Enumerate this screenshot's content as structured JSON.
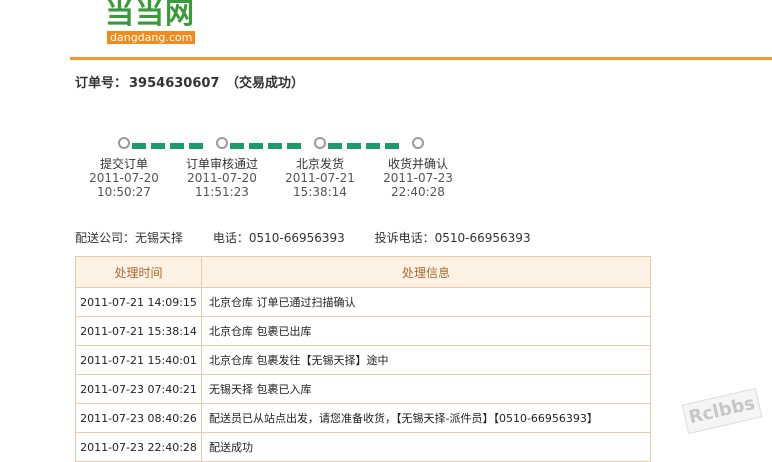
{
  "logo": {
    "cn": "当当网",
    "en": "dangdang.com"
  },
  "order": {
    "label": "订单号：",
    "number": "3954630607",
    "status": "（交易成功）"
  },
  "steps": [
    {
      "label": "提交订单",
      "date": "2011-07-20",
      "time": "10:50:27"
    },
    {
      "label": "订单审核通过",
      "date": "2011-07-20",
      "time": "11:51:23"
    },
    {
      "label": "北京发货",
      "date": "2011-07-21",
      "time": "15:38:14"
    },
    {
      "label": "收货并确认",
      "date": "2011-07-23",
      "time": "22:40:28"
    }
  ],
  "colors": {
    "accent": "#f29a2e",
    "progress": "#1f9a6a"
  },
  "delivery": {
    "company": "配送公司：无锡天择",
    "phone": "电话：0510-66956393",
    "complaint": "投诉电话：0510-66956393"
  },
  "table": {
    "headers": [
      "处理时间",
      "处理信息"
    ],
    "rows": [
      {
        "time": "2011-07-21 14:09:15",
        "info": "北京仓库 订单已通过扫描确认"
      },
      {
        "time": "2011-07-21 15:38:14",
        "info": "北京仓库 包裹已出库"
      },
      {
        "time": "2011-07-21 15:40:01",
        "info": "北京仓库 包裹发往【无锡天择】途中"
      },
      {
        "time": "2011-07-23 07:40:21",
        "info": "无锡天择 包裹已入库"
      },
      {
        "time": "2011-07-23 08:40:26",
        "info": "配送员已从站点出发，请您准备收货，【无锡天择-派件员】【0510-66956393】"
      },
      {
        "time": "2011-07-23 22:40:28",
        "info": "配送成功"
      }
    ]
  },
  "watermark": "Rclbbs"
}
